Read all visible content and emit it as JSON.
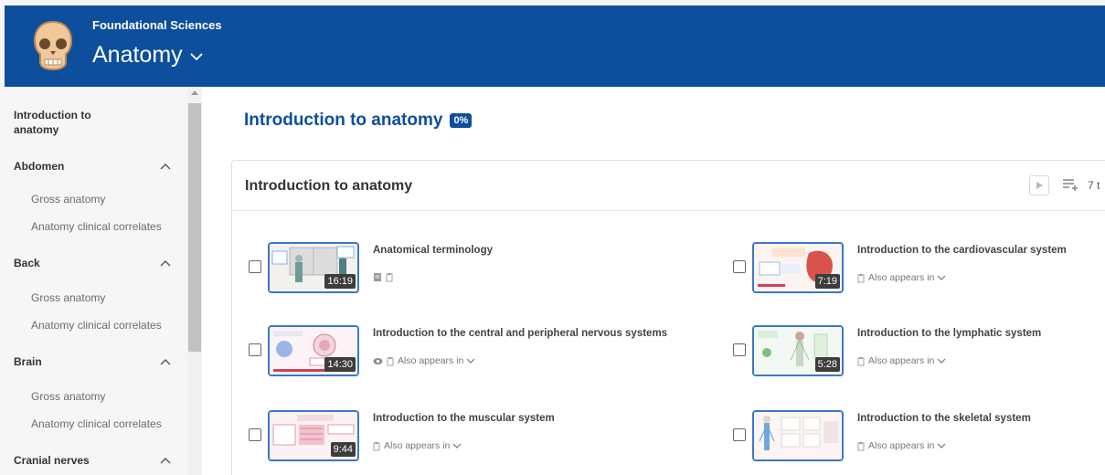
{
  "header": {
    "category": "Foundational Sciences",
    "subject": "Anatomy",
    "colors": {
      "brand": "#0d4f9c",
      "accent": "#3a78c9"
    }
  },
  "sidebar": {
    "intro": "Introduction to anatomy",
    "sections": [
      {
        "label": "Abdomen",
        "items": [
          "Gross anatomy",
          "Anatomy clinical correlates"
        ]
      },
      {
        "label": "Back",
        "items": [
          "Gross anatomy",
          "Anatomy clinical correlates"
        ]
      },
      {
        "label": "Brain",
        "items": [
          "Gross anatomy",
          "Anatomy clinical correlates"
        ]
      },
      {
        "label": "Cranial nerves",
        "items": []
      }
    ]
  },
  "main": {
    "title": "Introduction to anatomy",
    "progress": "0%",
    "card": {
      "title": "Introduction to anatomy",
      "count": "7 t",
      "also_appears": "Also appears in",
      "videos": [
        {
          "title": "Anatomical terminology",
          "duration": "16:19",
          "icons": [
            "notes-icon",
            "clipboard-icon"
          ],
          "also": false
        },
        {
          "title": "Introduction to the cardiovascular system",
          "duration": "7:19",
          "icons": [
            "clipboard-icon"
          ],
          "also": true
        },
        {
          "title": "Introduction to the central and peripheral nervous systems",
          "duration": "14:30",
          "icons": [
            "eye-icon",
            "clipboard-icon"
          ],
          "also": true
        },
        {
          "title": "Introduction to the lymphatic system",
          "duration": "5:28",
          "icons": [
            "clipboard-icon"
          ],
          "also": true
        },
        {
          "title": "Introduction to the muscular system",
          "duration": "9:44",
          "icons": [
            "clipboard-icon"
          ],
          "also": true
        },
        {
          "title": "Introduction to the skeletal system",
          "duration": "",
          "icons": [
            "clipboard-icon"
          ],
          "also": true
        }
      ]
    }
  }
}
